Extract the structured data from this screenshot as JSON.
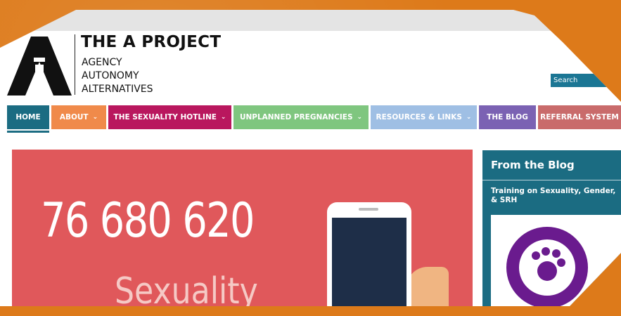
{
  "brand": {
    "title": "THE A PROJECT",
    "tagline": [
      "AGENCY",
      "AUTONOMY",
      "ALTERNATIVES"
    ]
  },
  "search": {
    "label": "Search"
  },
  "nav": [
    {
      "label": "HOME",
      "has_dropdown": false,
      "color": "#1b6c82",
      "active": true
    },
    {
      "label": "ABOUT",
      "has_dropdown": true,
      "color": "#f08a4a"
    },
    {
      "label": "THE SEXUALITY HOTLINE",
      "has_dropdown": true,
      "color": "#b9175e"
    },
    {
      "label": "UNPLANNED PREGNANCIES",
      "has_dropdown": true,
      "color": "#7fc67f"
    },
    {
      "label": "RESOURCES & LINKS",
      "has_dropdown": true,
      "color": "#9fbfe4"
    },
    {
      "label": "THE BLOG",
      "has_dropdown": false,
      "color": "#7b62b3"
    },
    {
      "label": "REFERRAL SYSTEM",
      "has_dropdown": false,
      "color": "#c96b6b"
    }
  ],
  "hero": {
    "phone_number": "76 680 620",
    "subtitle": "Sexuality"
  },
  "sidebar": {
    "title": "From the Blog",
    "post_title": "Training on Sexuality, Gender, & SRH"
  },
  "colors": {
    "background_orange": "#dd7a1a",
    "teal": "#1b6c82",
    "hero_red": "#e0585b"
  }
}
